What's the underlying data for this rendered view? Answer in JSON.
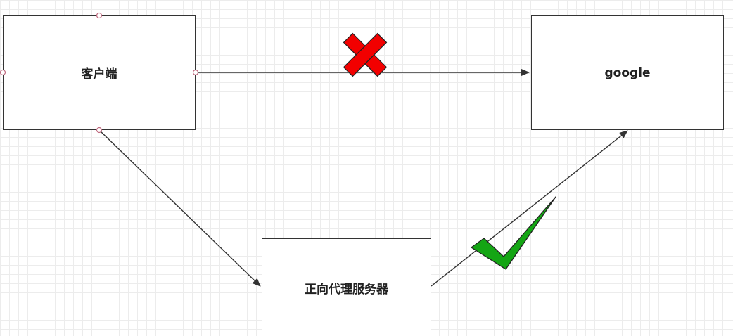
{
  "nodes": {
    "client": "客户端",
    "google": "google",
    "proxy": "正向代理服务器"
  },
  "colors": {
    "edge": "#333333",
    "cross": "#f20000",
    "check": "#14a514",
    "handle": "#c06b80",
    "grid": "#ececec"
  },
  "icons": {
    "blocked": "cross-mark-icon",
    "allowed": "check-mark-icon"
  }
}
